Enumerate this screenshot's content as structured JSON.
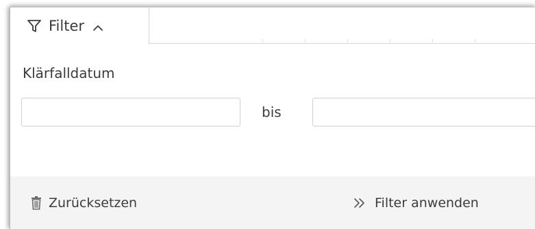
{
  "tab": {
    "label": "Filter",
    "icon": "filter-icon",
    "toggle_icon": "chevron-up-icon"
  },
  "filter": {
    "section_label": "Klärfalldatum",
    "from_value": "",
    "separator_label": "bis",
    "to_value": ""
  },
  "footer": {
    "reset_label": "Zurücksetzen",
    "reset_icon": "trash-icon",
    "apply_label": "Filter anwenden",
    "apply_icon": "double-chevron-right-icon"
  },
  "colors": {
    "text": "#3b3b3b",
    "border": "#cfcfcf",
    "footer_bg": "#f4f4f4"
  }
}
